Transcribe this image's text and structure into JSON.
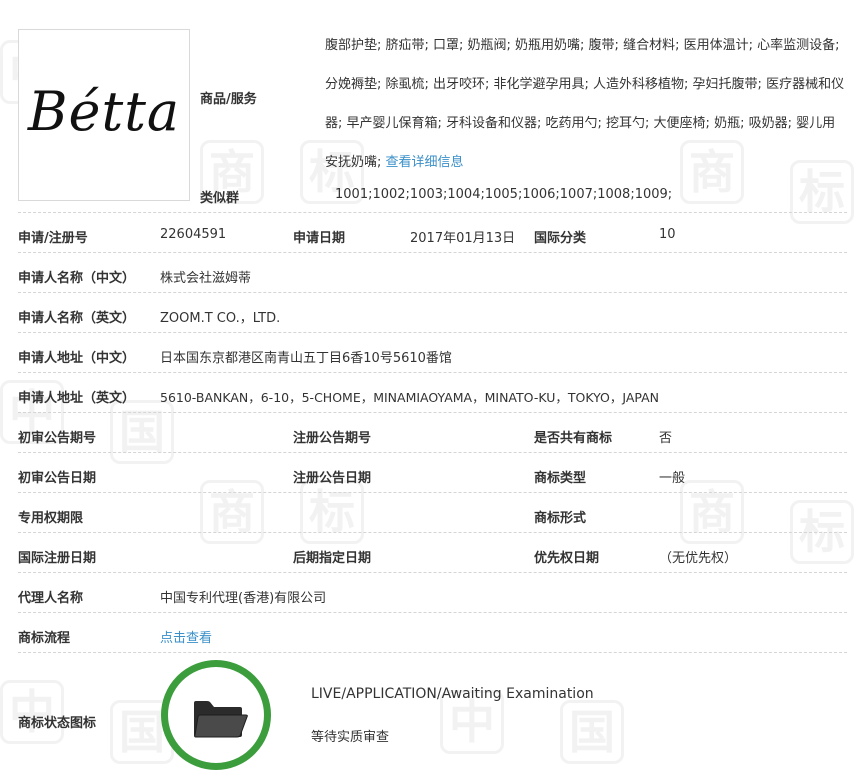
{
  "logo": {
    "text": "Bétta"
  },
  "goods_services": {
    "label": "商品/服务",
    "text": "腹部护垫; 脐疝带; 口罩; 奶瓶阀; 奶瓶用奶嘴; 腹带; 缝合材料; 医用体温计; 心率监测设备; 分娩褥垫; 除虱梳; 出牙咬环; 非化学避孕用具; 人造外科移植物; 孕妇托腹带; 医疗器械和仪器; 早产婴儿保育箱; 牙科设备和仪器; 吃药用勺; 挖耳勺; 大便座椅; 奶瓶; 吸奶器; 婴儿用安抚奶嘴;",
    "detail_link": "查看详细信息"
  },
  "similar_group": {
    "label": "类似群",
    "value": "1001;1002;1003;1004;1005;1006;1007;1008;1009;"
  },
  "registration": {
    "reg_no_label": "申请/注册号",
    "reg_no": "22604591",
    "app_date_label": "申请日期",
    "app_date": "2017年01月13日",
    "intl_class_label": "国际分类",
    "intl_class": "10"
  },
  "applicant": {
    "name_cn_label": "申请人名称（中文）",
    "name_cn": "株式会社滋姆蒂",
    "name_en_label": "申请人名称（英文）",
    "name_en": "ZOOM.T CO.，LTD.",
    "addr_cn_label": "申请人地址（中文）",
    "addr_cn": "日本国东京都港区南青山五丁目6香10号5610番馆",
    "addr_en_label": "申请人地址（英文）",
    "addr_en": "5610-BANKAN，6-10，5-CHOME，MINAMIAOYAMA，MINATO-KU，TOKYO，JAPAN"
  },
  "publication": {
    "prelim_no_label": "初审公告期号",
    "prelim_no": "",
    "reg_pub_no_label": "注册公告期号",
    "reg_pub_no": "",
    "shared_label": "是否共有商标",
    "shared": "否",
    "prelim_date_label": "初审公告日期",
    "prelim_date": "",
    "reg_pub_date_label": "注册公告日期",
    "reg_pub_date": "",
    "mark_type_label": "商标类型",
    "mark_type": "一般",
    "exclusive_label": "专用权期限",
    "exclusive": "",
    "mark_form_label": "商标形式",
    "mark_form": "",
    "intl_reg_date_label": "国际注册日期",
    "intl_reg_date": "",
    "later_date_label": "后期指定日期",
    "later_date": "",
    "priority_label": "优先权日期",
    "priority": "（无优先权）"
  },
  "agent": {
    "label": "代理人名称",
    "value": "中国专利代理(香港)有限公司"
  },
  "flow": {
    "label": "商标流程",
    "link": "点击查看"
  },
  "status": {
    "label": "商标状态图标",
    "en": "LIVE/APPLICATION/Awaiting Examination",
    "cn": "等待实质审查",
    "ring_color": "#3c9d3c",
    "icon": "folder-icon"
  },
  "colors": {
    "link": "#3a8fc9",
    "divider": "#d5d5d5"
  }
}
